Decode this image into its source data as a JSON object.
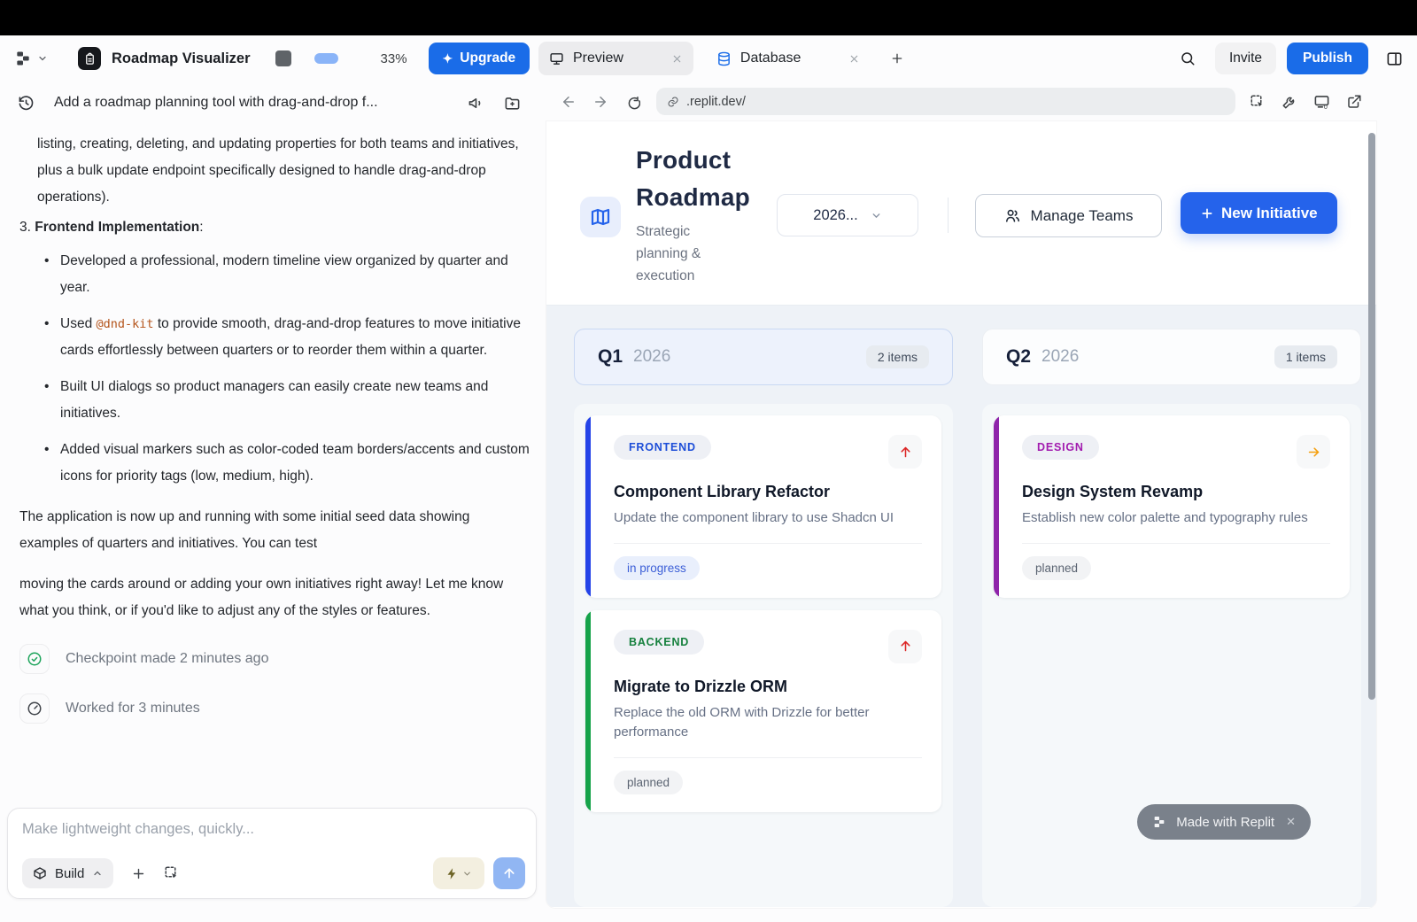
{
  "topbar": {
    "app_name": "Roadmap Visualizer",
    "usage_percent": "33%",
    "upgrade_label": "Upgrade",
    "tabs": [
      {
        "label": "Preview",
        "icon": "monitor-icon",
        "active": true
      },
      {
        "label": "Database",
        "icon": "database-icon",
        "active": false
      }
    ],
    "invite_label": "Invite",
    "publish_label": "Publish",
    "indicator_colors": {
      "cpu": "#5f6368",
      "ram": "#8ab4f8"
    }
  },
  "agent_panel": {
    "prompt_title": "Add a roadmap planning tool with drag-and-drop f...",
    "paragraph_top": "listing, creating, deleting, and updating properties for both teams and initiatives, plus a bulk update endpoint specifically designed to handle drag-and-drop operations).",
    "numbered_item": {
      "number": "3.",
      "title": "Frontend Implementation",
      "suffix": ":"
    },
    "bullets": [
      {
        "text": "Developed a professional, modern timeline view organized by quarter and year."
      },
      {
        "pre": "Used ",
        "code": "@dnd-kit",
        "post": " to provide smooth, drag-and-drop features to move initiative cards effortlessly between quarters or to reorder them within a quarter."
      },
      {
        "text": "Built UI dialogs so product managers can easily create new teams and initiatives."
      },
      {
        "text": "Added visual markers such as color-coded team borders/accents and custom icons for priority tags (low, medium, high)."
      }
    ],
    "paragraph_mid": "The application is now up and running with some initial seed data showing examples of quarters and initiatives. You can test",
    "paragraph_bottom": "moving the cards around or adding your own initiatives right away! Let me know what you think, or if you'd like to adjust any of the styles or features.",
    "status_rows": [
      {
        "icon": "check-circle-icon",
        "text": "Checkpoint made 2 minutes ago"
      },
      {
        "icon": "gauge-icon",
        "text": "Worked for 3 minutes"
      }
    ],
    "composer": {
      "placeholder": "Make lightweight changes, quickly...",
      "mode_label": "Build"
    }
  },
  "browser": {
    "url": ".replit.dev/"
  },
  "preview": {
    "title": "Product Roadmap",
    "subtitle": "Strategic planning & execution",
    "year_filter": "2026...",
    "manage_teams_label": "Manage Teams",
    "new_initiative_label": "New Initiative",
    "quarters": [
      {
        "name": "Q1",
        "year": "2026",
        "count": "2 items",
        "cards": [
          {
            "team": "FRONTEND",
            "team_color": "#1d4ed8",
            "accent": "#2544e8",
            "title": "Component Library Refactor",
            "description": "Update the component library to use Shadcn UI",
            "status": "in progress",
            "priority": "high"
          },
          {
            "team": "BACKEND",
            "team_color": "#15803d",
            "accent": "#16a34a",
            "title": "Migrate to Drizzle ORM",
            "description": "Replace the old ORM with Drizzle for better performance",
            "status": "planned",
            "priority": "high"
          }
        ]
      },
      {
        "name": "Q2",
        "year": "2026",
        "count": "1 items",
        "cards": [
          {
            "team": "DESIGN",
            "team_color": "#a21caf",
            "accent": "#8e24aa",
            "title": "Design System Revamp",
            "description": "Establish new color palette and typography rules",
            "status": "planned",
            "priority": "medium"
          }
        ]
      }
    ],
    "made_with_badge": "Made with Replit"
  },
  "colors": {
    "replit_blue": "#1a6ce8",
    "app_blue": "#2563eb",
    "board_bg": "#eef2f7"
  }
}
